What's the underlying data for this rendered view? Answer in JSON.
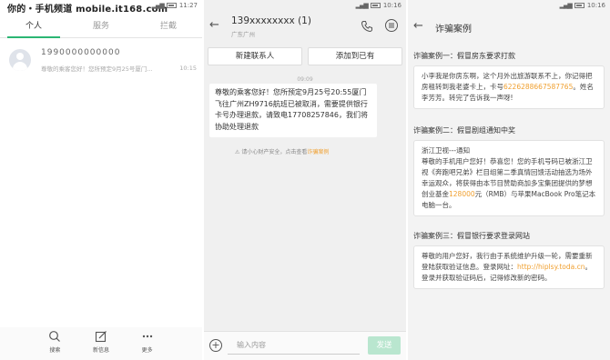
{
  "panel1": {
    "status": {
      "watermark": "你的・手机频道 mobile.it168.com",
      "time": "11:27"
    },
    "tabs": [
      "个人",
      "服务",
      "拦截"
    ],
    "active_tab": 0,
    "conversation": {
      "name": "1990000000000",
      "preview": "尊敬的乘客您好！您所预定9月25号厦门...",
      "time": "10:15"
    },
    "bottom_bar": [
      {
        "label": "搜索",
        "icon": "search-icon"
      },
      {
        "label": "新信息",
        "icon": "compose-icon"
      },
      {
        "label": "更多",
        "icon": "more-dots-icon"
      }
    ]
  },
  "panel2": {
    "status": {
      "time": "10:16"
    },
    "header": {
      "number": "139xxxxxxxx (1)",
      "location": "广东广州"
    },
    "buttons": {
      "new_contact": "新建联系人",
      "add_existing": "添加到已有"
    },
    "timestamp": "09:09",
    "message": "尊敬的乘客您好！您所预定9月25号20:55厦门飞往广州ZH9716航班已被取消，需要提供银行卡号办理退款，请致电17708257846，我们将协助处理退款",
    "safety_text": "请小心财产安全，点击查看",
    "safety_link": "诈骗案例",
    "input_placeholder": "输入内容",
    "send_label": "发送"
  },
  "panel3": {
    "status": {
      "time": "10:16"
    },
    "title": "诈骗案例",
    "cases": [
      {
        "title": "诈骗案例一：假冒房东要求打款",
        "parts": [
          {
            "text": "小李我是你房东啊，这个月外出旅游联系不上，你记得把房租转到我老婆卡上，卡号",
            "hl": false
          },
          {
            "text": "6226288667587765",
            "hl": true
          },
          {
            "text": "。姓名李芳芳。转完了告诉我一声呀!",
            "hl": false
          }
        ]
      },
      {
        "title": "诈骗案例二：假冒剧组通知中奖",
        "parts": [
          {
            "text": "浙江卫视---通知\n尊敬的手机用户您好！恭喜您！您的手机号码已被浙江卫视《奔跑吧兄弟》栏目组第二季真情回馈活动抽选为场外幸运观众，将获得由本节目赞助商加多宝集团提供的梦想创业基金",
            "hl": false
          },
          {
            "text": "128000",
            "hl": true
          },
          {
            "text": "元（RMB）与苹果MacBook Pro笔记本电脑一台。",
            "hl": false
          }
        ]
      },
      {
        "title": "诈骗案例三：假冒银行要求登录网站",
        "parts": [
          {
            "text": "尊敬的用户您好，我行由于系统维护升级一轮，需要重新登陆获取验证信息。登录网址：",
            "hl": false
          },
          {
            "text": "http://hiplsy.toda.cn",
            "hl": true
          },
          {
            "text": "。登录并获取验证码后，记得修改新的密码。",
            "hl": false
          }
        ]
      }
    ]
  },
  "colors": {
    "accent_green": "#2bb673",
    "highlight_orange": "#f0a030",
    "send_disabled": "#b9e6cf"
  }
}
